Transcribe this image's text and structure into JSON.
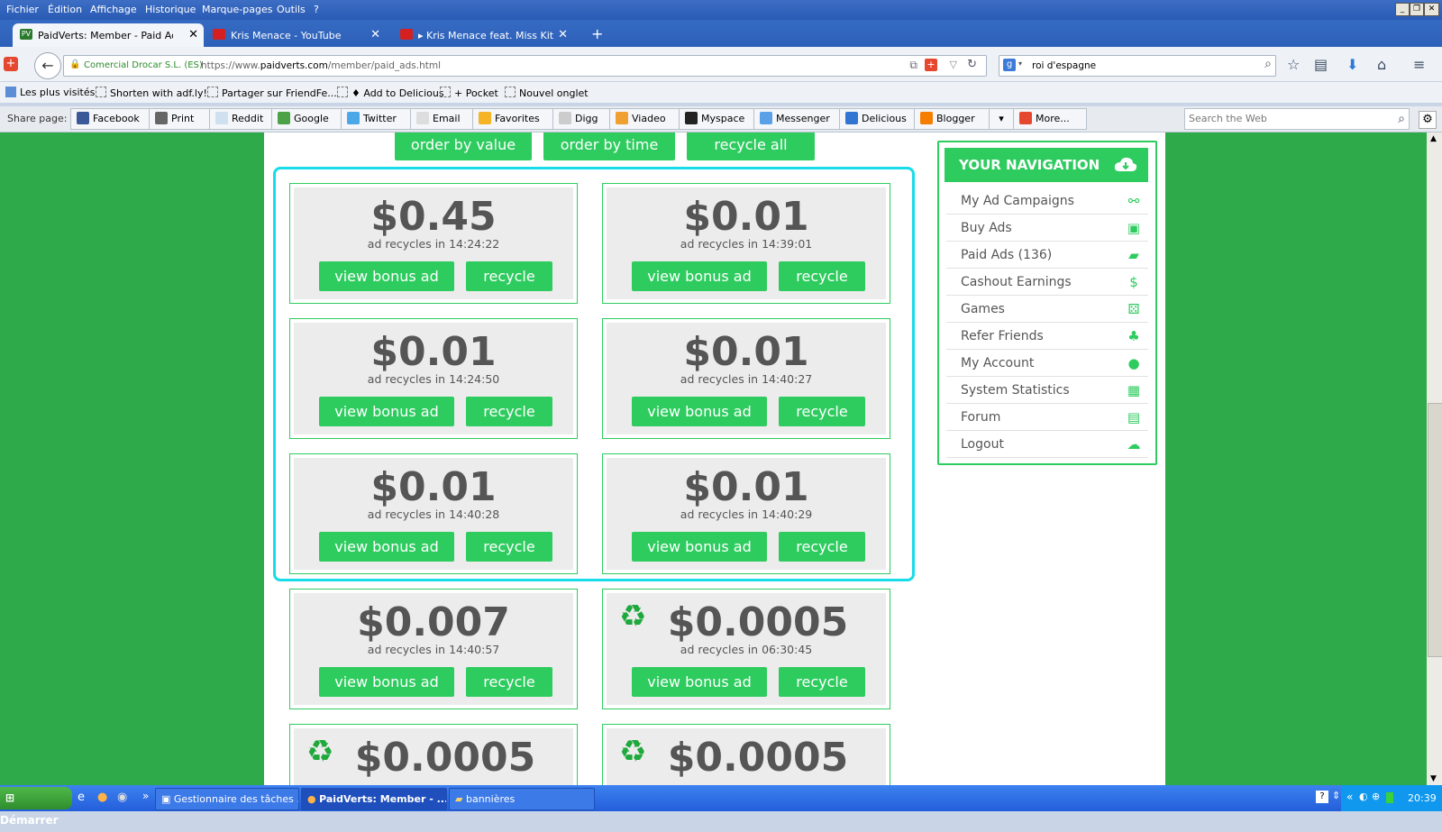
{
  "menu": [
    "Fichier",
    "Édition",
    "Affichage",
    "Historique",
    "Marque-pages",
    "Outils",
    "?"
  ],
  "tabs": [
    {
      "label": "PaidVerts: Member - Paid Ads",
      "active": true
    },
    {
      "label": "Kris Menace - YouTube",
      "active": false
    },
    {
      "label": "▸ Kris Menace feat. Miss Kitti...",
      "active": false
    }
  ],
  "tab_new": "+",
  "nav": {
    "site_identity": "Comercial Drocar S.L. (ES)",
    "url_prefix": "https://www.",
    "url_domain": "paidverts.com",
    "url_path": "/member/paid_ads.html",
    "search_value": "roi d'espagne"
  },
  "bookmarks": [
    "Les plus visités",
    "Shorten with adf.ly!",
    "Partager sur FriendFe...",
    "♦ Add to Delicious",
    "+ Pocket",
    "Nouvel onglet"
  ],
  "share": {
    "label": "Share page:",
    "items": [
      "Facebook",
      "Print",
      "Reddit",
      "Google",
      "Twitter",
      "Email",
      "Favorites",
      "Digg",
      "Viadeo",
      "Myspace",
      "Messenger",
      "Delicious",
      "Blogger",
      "More..."
    ],
    "search_placeholder": "Search the Web"
  },
  "controls": [
    "order by value",
    "order by time",
    "recycle all"
  ],
  "ads": [
    {
      "amount": "$0.45",
      "recycle_label": "ad recycles in",
      "time": "14:24:22",
      "icon": false
    },
    {
      "amount": "$0.01",
      "recycle_label": "ad recycles in",
      "time": "14:39:01",
      "icon": false
    },
    {
      "amount": "$0.01",
      "recycle_label": "ad recycles in",
      "time": "14:24:50",
      "icon": false
    },
    {
      "amount": "$0.01",
      "recycle_label": "ad recycles in",
      "time": "14:40:27",
      "icon": false
    },
    {
      "amount": "$0.01",
      "recycle_label": "ad recycles in",
      "time": "14:40:28",
      "icon": false
    },
    {
      "amount": "$0.01",
      "recycle_label": "ad recycles in",
      "time": "14:40:29",
      "icon": false
    },
    {
      "amount": "$0.007",
      "recycle_label": "ad recycles in",
      "time": "14:40:57",
      "icon": false
    },
    {
      "amount": "$0.0005",
      "recycle_label": "ad recycles in",
      "time": "06:30:45",
      "icon": true
    },
    {
      "amount": "$0.0005",
      "recycle_label": "",
      "time": "",
      "icon": true
    },
    {
      "amount": "$0.0005",
      "recycle_label": "",
      "time": "",
      "icon": true
    }
  ],
  "ad_buttons": {
    "view": "view bonus ad",
    "recycle": "recycle"
  },
  "navigation": {
    "title": "YOUR NAVIGATION",
    "items": [
      "My Ad Campaigns",
      "Buy Ads",
      "Paid Ads (136)",
      "Cashout Earnings",
      "Games",
      "Refer Friends",
      "My Account",
      "System Statistics",
      "Forum",
      "Logout"
    ]
  },
  "taskbar": {
    "start": "Démarrer",
    "tasks": [
      "Gestionnaire des tâches ...",
      "PaidVerts: Member - ...",
      "bannières"
    ],
    "clock": "20:39"
  },
  "colors": {
    "accent": "#2ecc5f",
    "page_bg": "#2eaa4a",
    "highlight": "#18dce8",
    "amount": "#555555"
  }
}
